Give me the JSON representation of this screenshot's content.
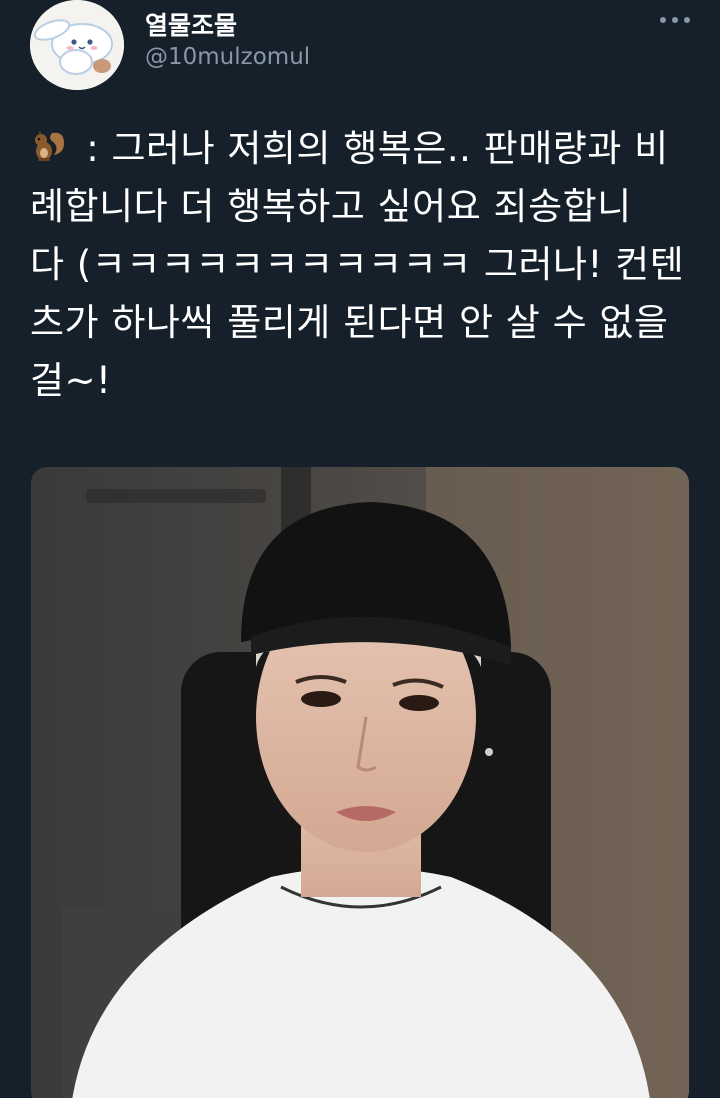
{
  "author": {
    "display_name": "열물조물",
    "handle": "@10mulzomul",
    "avatar_icon": "cinnamoroll-avatar-icon"
  },
  "more_icon": "more-dots-icon",
  "tweet": {
    "emoji_icon": "squirrel-icon",
    "lines": [
      " : 그러나 저희의 행복은.. 판매량과 비",
      "례합니다 더 행복하고 싶어요 죄송합니",
      "다 (ㅋㅋㅋㅋㅋㅋㅋㅋㅋㅋㅋ 그러나! 컨텐",
      "츠가 하나씩 풀리게 된다면 안 살 수 없을",
      "걸~!"
    ]
  },
  "media": {
    "type": "photo",
    "subject": "person-in-black-cap-white-tshirt"
  },
  "colors": {
    "background": "#15202b",
    "secondary_text": "#8899a6",
    "primary_text": "#ffffff"
  }
}
